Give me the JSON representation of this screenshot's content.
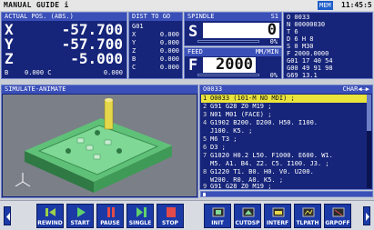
{
  "header": {
    "title": "MANUAL GUIDE i",
    "mem": "MEM",
    "clock": "11:45:5"
  },
  "actual_pos": {
    "title": "ACTUAL POS. (ABS.)",
    "axes": [
      {
        "name": "X",
        "value": "-57.700"
      },
      {
        "name": "Y",
        "value": "-57.700"
      },
      {
        "name": "Z",
        "value": "-5.000"
      }
    ],
    "b_label": "B",
    "b_value": "0.000 C",
    "c_value": "0.000"
  },
  "dist_to_go": {
    "title": "DIST TO GO",
    "program": "G01",
    "rows": [
      {
        "axis": "X",
        "value": "0.000"
      },
      {
        "axis": "Y",
        "value": "0.000"
      },
      {
        "axis": "Z",
        "value": "0.000"
      },
      {
        "axis": "B",
        "value": "0.000"
      },
      {
        "axis": "C",
        "value": "0.000"
      }
    ]
  },
  "spindle": {
    "title": "SPINDLE",
    "title_right": "S1",
    "label": "S",
    "value": "0",
    "pct": "0%",
    "pct_fill": 0
  },
  "feed": {
    "title": "FEED",
    "title_right": "MM/MIN",
    "label": "F",
    "value": "2000",
    "pct": "0%",
    "pct_fill": 0
  },
  "modal": {
    "lines": [
      "O 0033",
      "N 00000030",
      "T 6",
      "D 6      H 8",
      "S        0 M30",
      "F  2000.0000",
      "G01  17  40  54",
      "G00  49  91  98",
      "G69  13.1"
    ]
  },
  "simulate": {
    "title": "SIMULATE-ANIMATE"
  },
  "program": {
    "title": "O0033",
    "title_right": "CHAR◀—▶",
    "lines": [
      {
        "n": "1",
        "text": "O0033 (101-M NO MDI) ;"
      },
      {
        "n": "2",
        "text": "G91 G28 Z0 M19 ;"
      },
      {
        "n": "3",
        "text": "N01 M01 (FACE) ;"
      },
      {
        "n": "4",
        "text": "G1902 B200. D200. H50. I100."
      },
      {
        "n": "",
        "text": "J100. K5. ;"
      },
      {
        "n": "5",
        "text": "M6 T3 ;"
      },
      {
        "n": "6",
        "text": "D3 ;"
      },
      {
        "n": "7",
        "text": "G1020 H0.2 L50. F1000. E600. W1."
      },
      {
        "n": "",
        "text": "M5. A1. B4. Z2. C5. I100. J3. ;"
      },
      {
        "n": "8",
        "text": "G1220 T1. B0. H0. V0. U200."
      },
      {
        "n": "",
        "text": "W200. R0. A0. K5. ;"
      },
      {
        "n": "9",
        "text": "G91 G28 Z0 M19 ;"
      }
    ]
  },
  "softkeys": [
    {
      "label": "REWIND",
      "icon": "rewind-icon"
    },
    {
      "label": "START",
      "icon": "play-icon"
    },
    {
      "label": "PAUSE",
      "icon": "pause-icon"
    },
    {
      "label": "SINGLE",
      "icon": "single-step-icon"
    },
    {
      "label": "STOP",
      "icon": "stop-icon"
    },
    {
      "label": "INIT",
      "icon": "init-icon"
    },
    {
      "label": "CUTDSP",
      "icon": "cut-display-icon"
    },
    {
      "label": "INTERF",
      "icon": "interference-icon"
    },
    {
      "label": "TLPATH",
      "icon": "tool-path-icon"
    },
    {
      "label": "GRPOFF",
      "icon": "graphic-off-icon"
    }
  ],
  "colors": {
    "panel": "#16247a",
    "title": "#3a4fb8",
    "highlight": "#e9e33b",
    "softkey": "#1c3aa6"
  }
}
